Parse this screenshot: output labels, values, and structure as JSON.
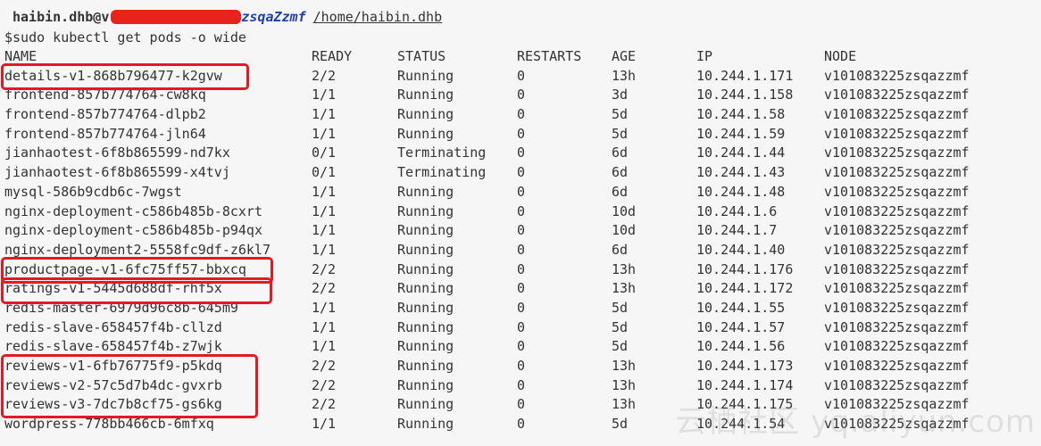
{
  "prompt": {
    "user_host_start": "haibin.dhb@v",
    "user_host_end": "zsqaZzmf",
    "path": "/home/haibin.dhb"
  },
  "command": "$sudo kubectl get pods -o wide",
  "table": {
    "headers": [
      "NAME",
      "READY",
      "STATUS",
      "RESTARTS",
      "AGE",
      "IP",
      "NODE"
    ],
    "rows": [
      {
        "name": "details-v1-868b796477-k2gvw",
        "ready": "2/2",
        "status": "Running",
        "restarts": "0",
        "age": "13h",
        "ip": "10.244.1.171",
        "node": "v101083225zsqazzmf"
      },
      {
        "name": "frontend-857b774764-cw8kq",
        "ready": "1/1",
        "status": "Running",
        "restarts": "0",
        "age": "3d",
        "ip": "10.244.1.158",
        "node": "v101083225zsqazzmf"
      },
      {
        "name": "frontend-857b774764-dlpb2",
        "ready": "1/1",
        "status": "Running",
        "restarts": "0",
        "age": "5d",
        "ip": "10.244.1.58",
        "node": "v101083225zsqazzmf"
      },
      {
        "name": "frontend-857b774764-jln64",
        "ready": "1/1",
        "status": "Running",
        "restarts": "0",
        "age": "5d",
        "ip": "10.244.1.59",
        "node": "v101083225zsqazzmf"
      },
      {
        "name": "jianhaotest-6f8b865599-nd7kx",
        "ready": "0/1",
        "status": "Terminating",
        "restarts": "0",
        "age": "6d",
        "ip": "10.244.1.44",
        "node": "v101083225zsqazzmf"
      },
      {
        "name": "jianhaotest-6f8b865599-x4tvj",
        "ready": "0/1",
        "status": "Terminating",
        "restarts": "0",
        "age": "6d",
        "ip": "10.244.1.43",
        "node": "v101083225zsqazzmf"
      },
      {
        "name": "mysql-586b9cdb6c-7wgst",
        "ready": "1/1",
        "status": "Running",
        "restarts": "0",
        "age": "6d",
        "ip": "10.244.1.48",
        "node": "v101083225zsqazzmf"
      },
      {
        "name": "nginx-deployment-c586b485b-8cxrt",
        "ready": "1/1",
        "status": "Running",
        "restarts": "0",
        "age": "10d",
        "ip": "10.244.1.6",
        "node": "v101083225zsqazzmf"
      },
      {
        "name": "nginx-deployment-c586b485b-p94qx",
        "ready": "1/1",
        "status": "Running",
        "restarts": "0",
        "age": "10d",
        "ip": "10.244.1.7",
        "node": "v101083225zsqazzmf"
      },
      {
        "name": "nginx-deployment2-5558fc9df-z6kl7",
        "ready": "1/1",
        "status": "Running",
        "restarts": "0",
        "age": "6d",
        "ip": "10.244.1.40",
        "node": "v101083225zsqazzmf"
      },
      {
        "name": "productpage-v1-6fc75ff57-bbxcq",
        "ready": "2/2",
        "status": "Running",
        "restarts": "0",
        "age": "13h",
        "ip": "10.244.1.176",
        "node": "v101083225zsqazzmf"
      },
      {
        "name": "ratings-v1-5445d688df-rhf5x",
        "ready": "2/2",
        "status": "Running",
        "restarts": "0",
        "age": "13h",
        "ip": "10.244.1.172",
        "node": "v101083225zsqazzmf"
      },
      {
        "name": "redis-master-6979d96c8b-645m9",
        "ready": "1/1",
        "status": "Running",
        "restarts": "0",
        "age": "5d",
        "ip": "10.244.1.55",
        "node": "v101083225zsqazzmf"
      },
      {
        "name": "redis-slave-658457f4b-cllzd",
        "ready": "1/1",
        "status": "Running",
        "restarts": "0",
        "age": "5d",
        "ip": "10.244.1.57",
        "node": "v101083225zsqazzmf"
      },
      {
        "name": "redis-slave-658457f4b-z7wjk",
        "ready": "1/1",
        "status": "Running",
        "restarts": "0",
        "age": "5d",
        "ip": "10.244.1.56",
        "node": "v101083225zsqazzmf"
      },
      {
        "name": "reviews-v1-6fb76775f9-p5kdq",
        "ready": "2/2",
        "status": "Running",
        "restarts": "0",
        "age": "13h",
        "ip": "10.244.1.173",
        "node": "v101083225zsqazzmf"
      },
      {
        "name": "reviews-v2-57c5d7b4dc-gvxrb",
        "ready": "2/2",
        "status": "Running",
        "restarts": "0",
        "age": "13h",
        "ip": "10.244.1.174",
        "node": "v101083225zsqazzmf"
      },
      {
        "name": "reviews-v3-7dc7b8cf75-gs6kg",
        "ready": "2/2",
        "status": "Running",
        "restarts": "0",
        "age": "13h",
        "ip": "10.244.1.175",
        "node": "v101083225zsqazzmf"
      },
      {
        "name": "wordpress-778bb466cb-6mfxq",
        "ready": "1/1",
        "status": "Running",
        "restarts": "0",
        "age": "5d",
        "ip": "10.244.1.54",
        "node": "v101083225zsqazzmf"
      }
    ]
  },
  "watermark": "云栖社区 yq.aliyun.com",
  "colors": {
    "background": "#f6f6f6",
    "text": "#333333",
    "highlight": "#e01b24",
    "redaction": "#e8231c",
    "host": "#1f3ea8"
  }
}
